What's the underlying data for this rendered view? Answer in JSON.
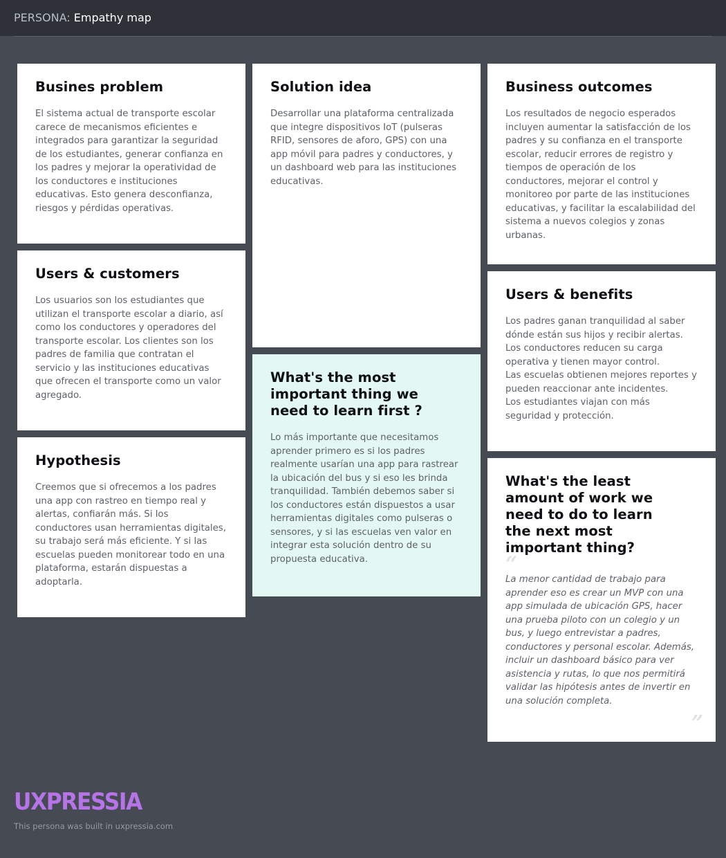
{
  "header": {
    "prefix": "PERSONA:",
    "title": "Empathy map"
  },
  "cards": {
    "business_problem": {
      "heading": "Busines problem",
      "body": "El sistema actual de transporte escolar carece de mecanismos eficientes e integrados para garantizar la seguridad de los estudiantes, generar confianza en los padres y mejorar la operatividad de los conductores e instituciones educativas. Esto genera desconfianza, riesgos y pérdidas operativas."
    },
    "solution_idea": {
      "heading": "Solution idea",
      "body": "Desarrollar una plataforma centralizada que integre dispositivos IoT (pulseras RFID, sensores de aforo, GPS) con una app móvil para padres y conductores, y un dashboard web para las instituciones educativas."
    },
    "business_outcomes": {
      "heading": "Business outcomes",
      "body": "Los resultados de negocio esperados incluyen aumentar la satisfacción de los padres y su confianza en el transporte escolar, reducir errores de registro y tiempos de operación de los conductores, mejorar el control y monitoreo por parte de las instituciones educativas, y facilitar la escalabilidad del sistema a nuevos colegios y zonas urbanas."
    },
    "users_customers": {
      "heading": "Users & customers",
      "body": "Los usuarios son los estudiantes que utilizan el transporte escolar a diario, así como los conductores y operadores del transporte escolar. Los clientes son los padres de familia que contratan el servicio y las instituciones educativas que ofrecen el transporte como un valor agregado."
    },
    "users_benefits": {
      "heading": "Users & benefits",
      "body": "Los padres ganan tranquilidad al saber dónde están sus hijos y recibir alertas.\nLos conductores reducen su carga operativa y tienen mayor control.\nLas escuelas obtienen mejores reportes y pueden reaccionar ante incidentes.\nLos estudiantes viajan con más seguridad y protección."
    },
    "hypothesis": {
      "heading": "Hypothesis",
      "body": "Creemos que si ofrecemos a los padres una app con rastreo en tiempo real y alertas, confiarán más. Si los conductores usan herramientas digitales, su trabajo será más eficiente. Y si las escuelas pueden monitorear todo en una plataforma, estarán dispuestas a adoptarla."
    },
    "most_important": {
      "heading": "What's the most important thing we need to learn first ?",
      "body": "Lo más importante que necesitamos aprender primero es si los padres realmente usarían una app para rastrear la ubicación del bus y si eso les brinda tranquilidad. También debemos saber si los conductores están dispuestos a usar herramientas digitales como pulseras o sensores, y si las escuelas ven valor en integrar esta solución dentro de su propuesta educativa."
    },
    "least_work": {
      "heading": "What's the least amount of work we need to do to learn the next most important thing?",
      "quote_open": "“",
      "body": "La menor cantidad de trabajo para aprender eso es crear un MVP con una app simulada de ubicación GPS, hacer una prueba piloto con un colegio y un bus, y luego entrevistar a padres, conductores y personal escolar. Además, incluir un dashboard básico para ver asistencia y rutas, lo que nos permitirá validar las hipótesis antes de invertir en una solución completa.",
      "quote_close": "”"
    }
  },
  "footer": {
    "logo": "UXPRESSIA",
    "credit": "This persona was built in uxpressia.com"
  },
  "colors": {
    "page_bg": "#454a53",
    "header_bg": "#2e3238",
    "card_bg": "#ffffff",
    "highlight_card_bg": "#e3f8f2",
    "logo": "#b674e8"
  }
}
